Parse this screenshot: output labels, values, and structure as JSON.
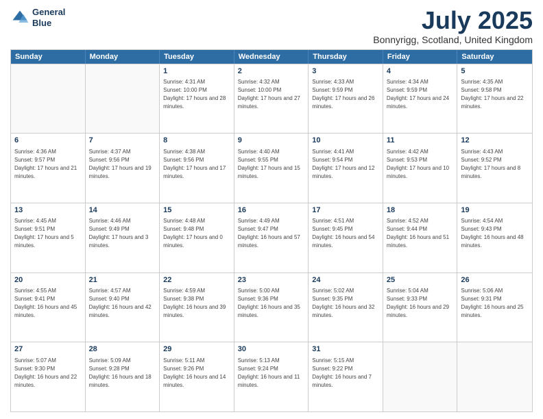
{
  "logo": {
    "line1": "General",
    "line2": "Blue"
  },
  "title": {
    "month_year": "July 2025",
    "location": "Bonnyrigg, Scotland, United Kingdom"
  },
  "days": [
    "Sunday",
    "Monday",
    "Tuesday",
    "Wednesday",
    "Thursday",
    "Friday",
    "Saturday"
  ],
  "weeks": [
    [
      {
        "date": "",
        "sunrise": "",
        "sunset": "",
        "daylight": ""
      },
      {
        "date": "",
        "sunrise": "",
        "sunset": "",
        "daylight": ""
      },
      {
        "date": "1",
        "sunrise": "Sunrise: 4:31 AM",
        "sunset": "Sunset: 10:00 PM",
        "daylight": "Daylight: 17 hours and 28 minutes."
      },
      {
        "date": "2",
        "sunrise": "Sunrise: 4:32 AM",
        "sunset": "Sunset: 10:00 PM",
        "daylight": "Daylight: 17 hours and 27 minutes."
      },
      {
        "date": "3",
        "sunrise": "Sunrise: 4:33 AM",
        "sunset": "Sunset: 9:59 PM",
        "daylight": "Daylight: 17 hours and 26 minutes."
      },
      {
        "date": "4",
        "sunrise": "Sunrise: 4:34 AM",
        "sunset": "Sunset: 9:59 PM",
        "daylight": "Daylight: 17 hours and 24 minutes."
      },
      {
        "date": "5",
        "sunrise": "Sunrise: 4:35 AM",
        "sunset": "Sunset: 9:58 PM",
        "daylight": "Daylight: 17 hours and 22 minutes."
      }
    ],
    [
      {
        "date": "6",
        "sunrise": "Sunrise: 4:36 AM",
        "sunset": "Sunset: 9:57 PM",
        "daylight": "Daylight: 17 hours and 21 minutes."
      },
      {
        "date": "7",
        "sunrise": "Sunrise: 4:37 AM",
        "sunset": "Sunset: 9:56 PM",
        "daylight": "Daylight: 17 hours and 19 minutes."
      },
      {
        "date": "8",
        "sunrise": "Sunrise: 4:38 AM",
        "sunset": "Sunset: 9:56 PM",
        "daylight": "Daylight: 17 hours and 17 minutes."
      },
      {
        "date": "9",
        "sunrise": "Sunrise: 4:40 AM",
        "sunset": "Sunset: 9:55 PM",
        "daylight": "Daylight: 17 hours and 15 minutes."
      },
      {
        "date": "10",
        "sunrise": "Sunrise: 4:41 AM",
        "sunset": "Sunset: 9:54 PM",
        "daylight": "Daylight: 17 hours and 12 minutes."
      },
      {
        "date": "11",
        "sunrise": "Sunrise: 4:42 AM",
        "sunset": "Sunset: 9:53 PM",
        "daylight": "Daylight: 17 hours and 10 minutes."
      },
      {
        "date": "12",
        "sunrise": "Sunrise: 4:43 AM",
        "sunset": "Sunset: 9:52 PM",
        "daylight": "Daylight: 17 hours and 8 minutes."
      }
    ],
    [
      {
        "date": "13",
        "sunrise": "Sunrise: 4:45 AM",
        "sunset": "Sunset: 9:51 PM",
        "daylight": "Daylight: 17 hours and 5 minutes."
      },
      {
        "date": "14",
        "sunrise": "Sunrise: 4:46 AM",
        "sunset": "Sunset: 9:49 PM",
        "daylight": "Daylight: 17 hours and 3 minutes."
      },
      {
        "date": "15",
        "sunrise": "Sunrise: 4:48 AM",
        "sunset": "Sunset: 9:48 PM",
        "daylight": "Daylight: 17 hours and 0 minutes."
      },
      {
        "date": "16",
        "sunrise": "Sunrise: 4:49 AM",
        "sunset": "Sunset: 9:47 PM",
        "daylight": "Daylight: 16 hours and 57 minutes."
      },
      {
        "date": "17",
        "sunrise": "Sunrise: 4:51 AM",
        "sunset": "Sunset: 9:45 PM",
        "daylight": "Daylight: 16 hours and 54 minutes."
      },
      {
        "date": "18",
        "sunrise": "Sunrise: 4:52 AM",
        "sunset": "Sunset: 9:44 PM",
        "daylight": "Daylight: 16 hours and 51 minutes."
      },
      {
        "date": "19",
        "sunrise": "Sunrise: 4:54 AM",
        "sunset": "Sunset: 9:43 PM",
        "daylight": "Daylight: 16 hours and 48 minutes."
      }
    ],
    [
      {
        "date": "20",
        "sunrise": "Sunrise: 4:55 AM",
        "sunset": "Sunset: 9:41 PM",
        "daylight": "Daylight: 16 hours and 45 minutes."
      },
      {
        "date": "21",
        "sunrise": "Sunrise: 4:57 AM",
        "sunset": "Sunset: 9:40 PM",
        "daylight": "Daylight: 16 hours and 42 minutes."
      },
      {
        "date": "22",
        "sunrise": "Sunrise: 4:59 AM",
        "sunset": "Sunset: 9:38 PM",
        "daylight": "Daylight: 16 hours and 39 minutes."
      },
      {
        "date": "23",
        "sunrise": "Sunrise: 5:00 AM",
        "sunset": "Sunset: 9:36 PM",
        "daylight": "Daylight: 16 hours and 35 minutes."
      },
      {
        "date": "24",
        "sunrise": "Sunrise: 5:02 AM",
        "sunset": "Sunset: 9:35 PM",
        "daylight": "Daylight: 16 hours and 32 minutes."
      },
      {
        "date": "25",
        "sunrise": "Sunrise: 5:04 AM",
        "sunset": "Sunset: 9:33 PM",
        "daylight": "Daylight: 16 hours and 29 minutes."
      },
      {
        "date": "26",
        "sunrise": "Sunrise: 5:06 AM",
        "sunset": "Sunset: 9:31 PM",
        "daylight": "Daylight: 16 hours and 25 minutes."
      }
    ],
    [
      {
        "date": "27",
        "sunrise": "Sunrise: 5:07 AM",
        "sunset": "Sunset: 9:30 PM",
        "daylight": "Daylight: 16 hours and 22 minutes."
      },
      {
        "date": "28",
        "sunrise": "Sunrise: 5:09 AM",
        "sunset": "Sunset: 9:28 PM",
        "daylight": "Daylight: 16 hours and 18 minutes."
      },
      {
        "date": "29",
        "sunrise": "Sunrise: 5:11 AM",
        "sunset": "Sunset: 9:26 PM",
        "daylight": "Daylight: 16 hours and 14 minutes."
      },
      {
        "date": "30",
        "sunrise": "Sunrise: 5:13 AM",
        "sunset": "Sunset: 9:24 PM",
        "daylight": "Daylight: 16 hours and 11 minutes."
      },
      {
        "date": "31",
        "sunrise": "Sunrise: 5:15 AM",
        "sunset": "Sunset: 9:22 PM",
        "daylight": "Daylight: 16 hours and 7 minutes."
      },
      {
        "date": "",
        "sunrise": "",
        "sunset": "",
        "daylight": ""
      },
      {
        "date": "",
        "sunrise": "",
        "sunset": "",
        "daylight": ""
      }
    ]
  ]
}
